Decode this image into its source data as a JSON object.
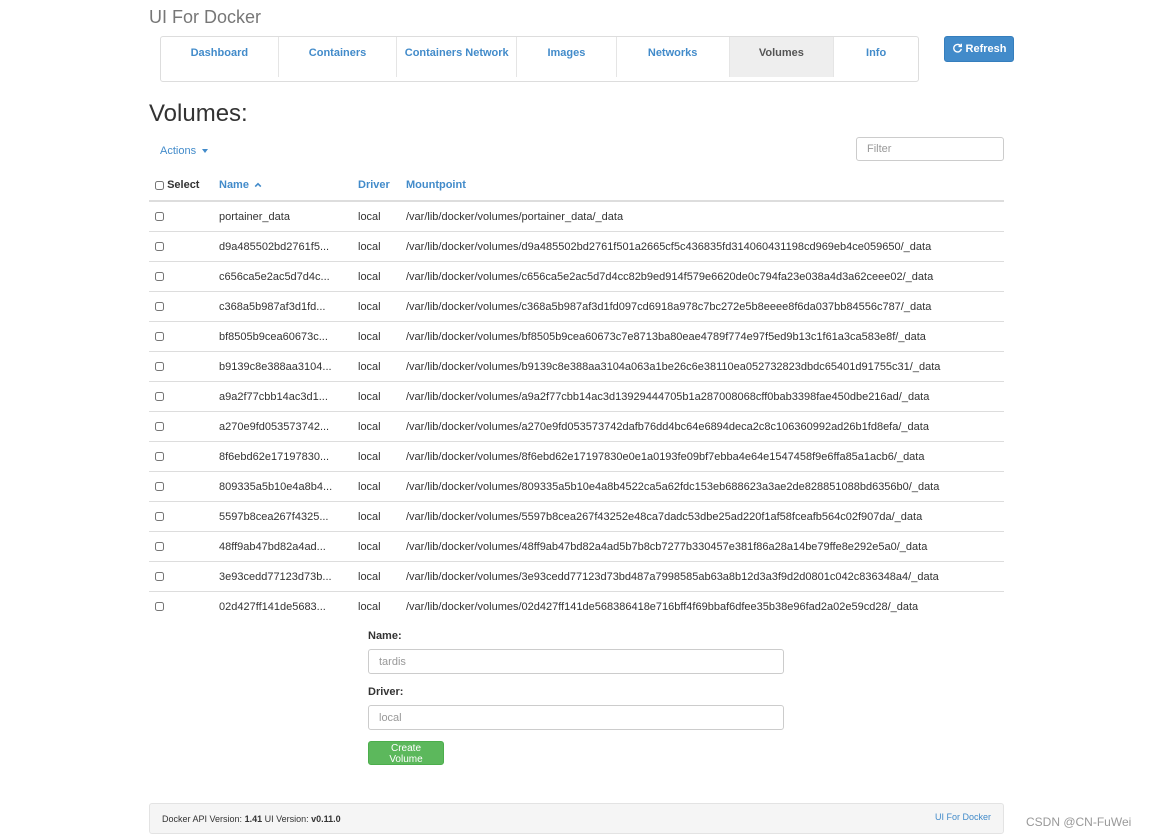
{
  "app_title": "UI For Docker",
  "nav": {
    "tabs": [
      {
        "label": "Dashboard"
      },
      {
        "label": "Containers"
      },
      {
        "label": "Containers Network"
      },
      {
        "label": "Images"
      },
      {
        "label": "Networks"
      },
      {
        "label": "Volumes",
        "active": true
      },
      {
        "label": "Info"
      }
    ]
  },
  "refresh_label": "Refresh",
  "page_heading": "Volumes:",
  "actions_label": "Actions",
  "filter_placeholder": "Filter",
  "table": {
    "headers": {
      "select": "Select",
      "name": "Name",
      "driver": "Driver",
      "mountpoint": "Mountpoint"
    },
    "sort_icon": "chevron-up-icon",
    "rows": [
      {
        "name": "portainer_data",
        "driver": "local",
        "mountpoint": "/var/lib/docker/volumes/portainer_data/_data"
      },
      {
        "name": "d9a485502bd2761f5...",
        "driver": "local",
        "mountpoint": "/var/lib/docker/volumes/d9a485502bd2761f501a2665cf5c436835fd314060431198cd969eb4ce059650/_data"
      },
      {
        "name": "c656ca5e2ac5d7d4c...",
        "driver": "local",
        "mountpoint": "/var/lib/docker/volumes/c656ca5e2ac5d7d4cc82b9ed914f579e6620de0c794fa23e038a4d3a62ceee02/_data"
      },
      {
        "name": "c368a5b987af3d1fd...",
        "driver": "local",
        "mountpoint": "/var/lib/docker/volumes/c368a5b987af3d1fd097cd6918a978c7bc272e5b8eeee8f6da037bb84556c787/_data"
      },
      {
        "name": "bf8505b9cea60673c...",
        "driver": "local",
        "mountpoint": "/var/lib/docker/volumes/bf8505b9cea60673c7e8713ba80eae4789f774e97f5ed9b13c1f61a3ca583e8f/_data"
      },
      {
        "name": "b9139c8e388aa3104...",
        "driver": "local",
        "mountpoint": "/var/lib/docker/volumes/b9139c8e388aa3104a063a1be26c6e38110ea052732823dbdc65401d91755c31/_data"
      },
      {
        "name": "a9a2f77cbb14ac3d1...",
        "driver": "local",
        "mountpoint": "/var/lib/docker/volumes/a9a2f77cbb14ac3d13929444705b1a287008068cff0bab3398fae450dbe216ad/_data"
      },
      {
        "name": "a270e9fd053573742...",
        "driver": "local",
        "mountpoint": "/var/lib/docker/volumes/a270e9fd053573742dafb76dd4bc64e6894deca2c8c106360992ad26b1fd8efa/_data"
      },
      {
        "name": "8f6ebd62e17197830...",
        "driver": "local",
        "mountpoint": "/var/lib/docker/volumes/8f6ebd62e17197830e0e1a0193fe09bf7ebba4e64e1547458f9e6ffa85a1acb6/_data"
      },
      {
        "name": "809335a5b10e4a8b4...",
        "driver": "local",
        "mountpoint": "/var/lib/docker/volumes/809335a5b10e4a8b4522ca5a62fdc153eb688623a3ae2de828851088bd6356b0/_data"
      },
      {
        "name": "5597b8cea267f4325...",
        "driver": "local",
        "mountpoint": "/var/lib/docker/volumes/5597b8cea267f43252e48ca7dadc53dbe25ad220f1af58fceafb564c02f907da/_data"
      },
      {
        "name": "48ff9ab47bd82a4ad...",
        "driver": "local",
        "mountpoint": "/var/lib/docker/volumes/48ff9ab47bd82a4ad5b7b8cb7277b330457e381f86a28a14be79ffe8e292e5a0/_data"
      },
      {
        "name": "3e93cedd77123d73b...",
        "driver": "local",
        "mountpoint": "/var/lib/docker/volumes/3e93cedd77123d73bd487a7998585ab63a8b12d3a3f9d2d0801c042c836348a4/_data"
      },
      {
        "name": "02d427ff141de5683...",
        "driver": "local",
        "mountpoint": "/var/lib/docker/volumes/02d427ff141de568386418e716bff4f69bbaf6dfee35b38e96fad2a02e59cd28/_data"
      }
    ]
  },
  "form": {
    "name_label": "Name:",
    "name_placeholder": "tardis",
    "driver_label": "Driver:",
    "driver_placeholder": "local",
    "create_label": "Create Volume"
  },
  "footer": {
    "api_version_label": "Docker API Version:",
    "api_version": "1.41",
    "ui_version_label": "UI Version:",
    "ui_version": "v0.11.0",
    "link": "UI For Docker"
  },
  "watermark": "CSDN @CN-FuWei",
  "colors": {
    "primary": "#428bca",
    "success": "#5cb85c"
  }
}
